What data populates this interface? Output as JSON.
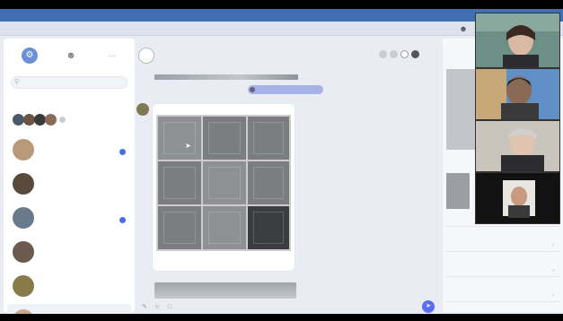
{
  "window": {
    "title": ""
  },
  "tabs": [
    {
      "label": ""
    },
    {
      "label": ""
    }
  ],
  "left_panel": {
    "search_placeholder": "",
    "chats": [
      {
        "name": "",
        "preview": "",
        "time": "",
        "unread": true,
        "avatar_color": "#b89a7a"
      },
      {
        "name": "",
        "preview": "",
        "time": "",
        "unread": false,
        "avatar_color": "#5a4a3e"
      },
      {
        "name": "",
        "preview": "",
        "time": "",
        "unread": true,
        "avatar_color": "#6a7a8a"
      },
      {
        "name": "",
        "preview": "",
        "time": "",
        "unread": false,
        "avatar_color": "#6b5a4d"
      },
      {
        "name": "",
        "preview": "",
        "time": "",
        "unread": false,
        "avatar_color": "#8a7a4a"
      },
      {
        "name": "",
        "preview": "",
        "time": "",
        "unread": false,
        "avatar_color": "#c8a890"
      }
    ]
  },
  "chat": {
    "title": "",
    "subtitle": "",
    "pill_text": "",
    "sender_name": "",
    "caption_title": "",
    "caption_sub": "",
    "composer_placeholder": ""
  },
  "right_panel": {
    "items": [
      {
        "label": ""
      },
      {
        "label": ""
      },
      {
        "label": ""
      },
      {
        "label": ""
      }
    ]
  },
  "colors": {
    "accent": "#5b6ef0",
    "titlebar": "#3f6fb0"
  },
  "icons": [
    "gear-icon",
    "person-icon",
    "more-icon",
    "search-icon",
    "phone-icon",
    "video-icon",
    "attach-icon",
    "emoji-icon",
    "send-icon",
    "chevron-right-icon",
    "cursor-icon"
  ]
}
